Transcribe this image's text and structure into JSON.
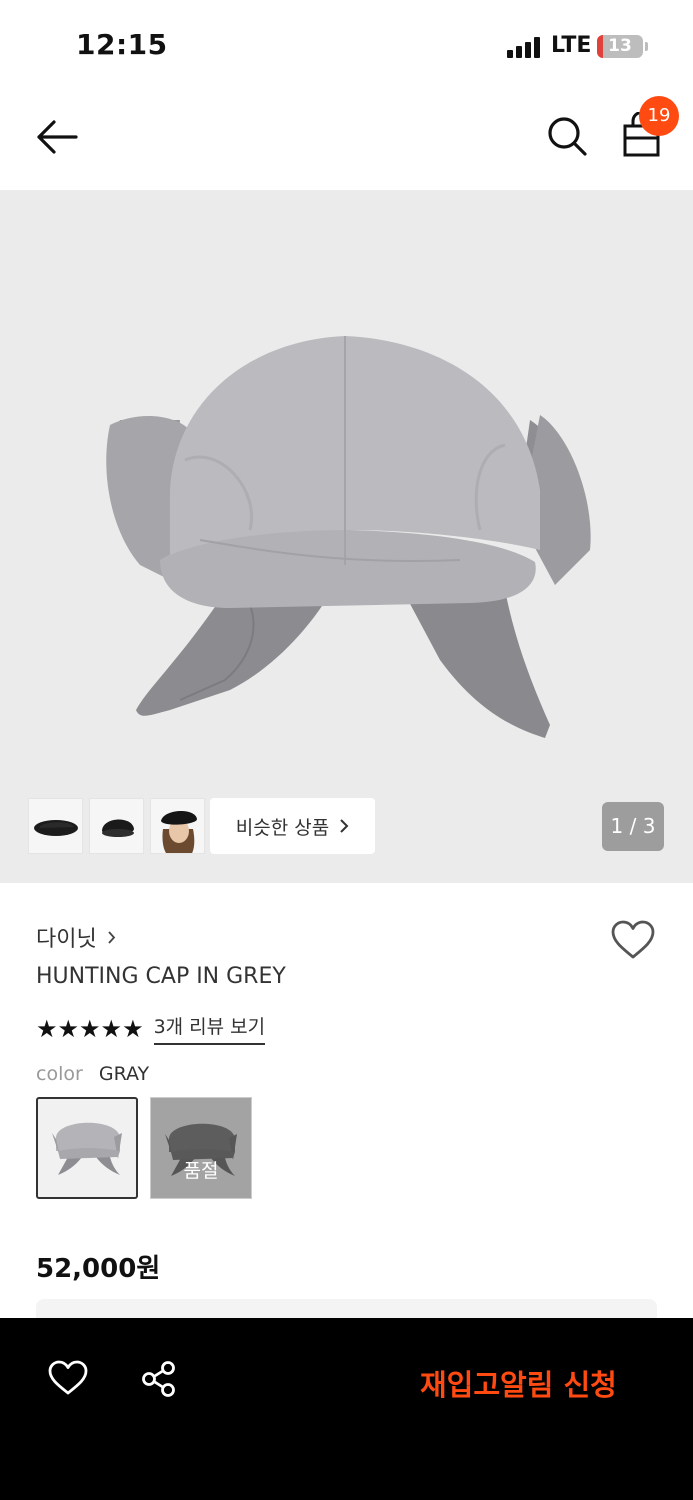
{
  "status_bar": {
    "time": "12:15",
    "network": "LTE",
    "battery": "13",
    "battery_level": 0.13,
    "battery_color": "#e0413a"
  },
  "header": {
    "back_icon": "arrow-left-icon",
    "search_icon": "search-icon",
    "cart_icon": "shopping-bag-icon",
    "cart_count": "19",
    "badge_color": "#ff4a12"
  },
  "gallery": {
    "thumbnails": [
      {
        "icon": "black-cap-thumbnail"
      },
      {
        "icon": "black-cap-side-thumbnail"
      },
      {
        "icon": "model-wearing-cap-thumbnail"
      }
    ],
    "similar_label": "비슷한 상품",
    "page_indicator": "1 / 3"
  },
  "product": {
    "brand": "다이닛",
    "title": "HUNTING CAP IN GREY",
    "stars": "★★★★★",
    "rating": 5,
    "review_link": "3개 리뷰 보기",
    "color_label": "color",
    "color_value": "GRAY",
    "swatches": [
      {
        "name": "gray",
        "sold_out": false
      },
      {
        "name": "charcoal",
        "sold_out": true,
        "status": "품절"
      }
    ],
    "price": "52,000원"
  },
  "bottom_bar": {
    "restock_label": "재입고알림 신청",
    "accent": "#ff4a12"
  }
}
